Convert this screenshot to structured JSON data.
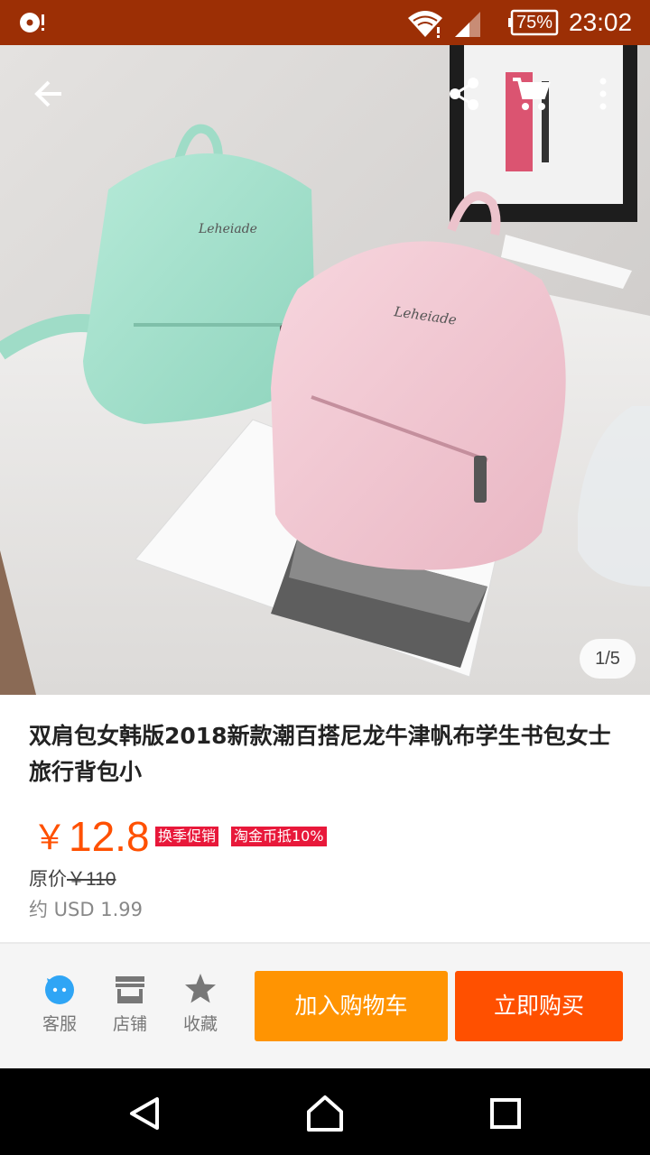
{
  "status_bar": {
    "battery": "75%",
    "time": "23:02"
  },
  "gallery": {
    "counter": "1/5"
  },
  "product": {
    "title": "双肩包女韩版2018新款潮百搭尼龙牛津帆布学生书包女士旅行背包小",
    "price_symbol": "￥",
    "price": "12.8",
    "promo_tags": [
      "换季促销",
      "淘金币抵10%"
    ],
    "original_price_label": "原价",
    "original_price": "￥110",
    "usd_price": "约 USD 1.99"
  },
  "action_bar": {
    "service_label": "客服",
    "shop_label": "店铺",
    "favorite_label": "收藏",
    "add_to_cart": "加入购物车",
    "buy_now": "立即购买"
  },
  "colors": {
    "status_bar": "#9c2f05",
    "price": "#ff5000",
    "promo_tag": "#e8183a",
    "add_to_cart": "#ff9402",
    "buy_now": "#ff5000",
    "service_icon": "#2fa5f5"
  }
}
